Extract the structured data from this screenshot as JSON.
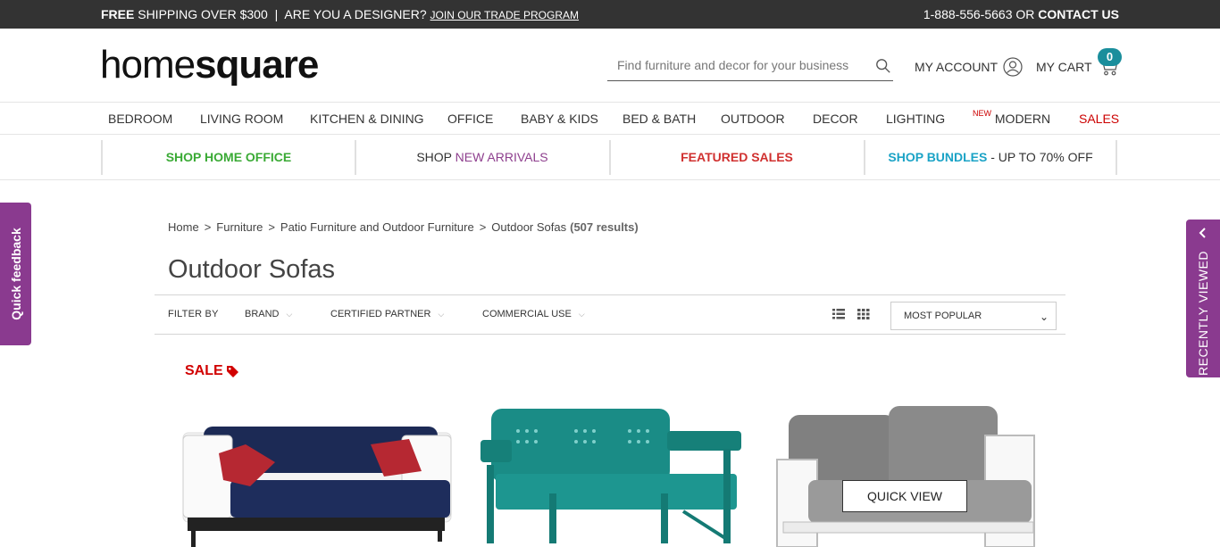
{
  "topbar": {
    "free": "FREE",
    "shipping": "SHIPPING OVER $300",
    "pipe": "|",
    "designer": "ARE YOU A DESIGNER?",
    "trade_link": "JOIN OUR TRADE PROGRAM",
    "phone": "1-888-556-5663 OR",
    "contact": "CONTACT US"
  },
  "header": {
    "logo_light": "home",
    "logo_bold": "square",
    "search_placeholder": "Find furniture and decor for your business",
    "account_label": "MY ACCOUNT",
    "cart_label": "MY CART",
    "cart_count": "0"
  },
  "nav": {
    "items": [
      "BEDROOM",
      "LIVING ROOM",
      "KITCHEN & DINING",
      "OFFICE",
      "BABY & KIDS",
      "BED & BATH",
      "OUTDOOR",
      "DECOR",
      "LIGHTING"
    ],
    "new_tag": "NEW",
    "modern": "MODERN",
    "sales": "SALES"
  },
  "promo": {
    "home_office": "SHOP HOME OFFICE",
    "shop": "SHOP",
    "new_arrivals": "NEW ARRIVALS",
    "featured_sales": "FEATURED SALES",
    "bundles": "SHOP BUNDLES",
    "bundles_suffix": " - UP TO 70% OFF"
  },
  "side": {
    "feedback": "Quick feedback",
    "recent": "RECENTLY VIEWED"
  },
  "breadcrumb": {
    "items": [
      "Home",
      "Furniture",
      "Patio Furniture and Outdoor Furniture",
      "Outdoor Sofas"
    ],
    "sep": ">",
    "count": "(507 results)"
  },
  "page_title": "Outdoor Sofas",
  "filters": {
    "label": "FILTER BY",
    "brand": "BRAND",
    "certified": "CERTIFIED PARTNER",
    "commercial": "COMMERCIAL USE",
    "sort_value": "MOST POPULAR"
  },
  "products": {
    "sale_label": "SALE",
    "quick_view": "QUICK VIEW"
  },
  "colors": {
    "topbar": "#333333",
    "accent_purple": "#8a3a8f",
    "cart_badge": "#1a8e9c",
    "sale_red": "#d10000"
  }
}
